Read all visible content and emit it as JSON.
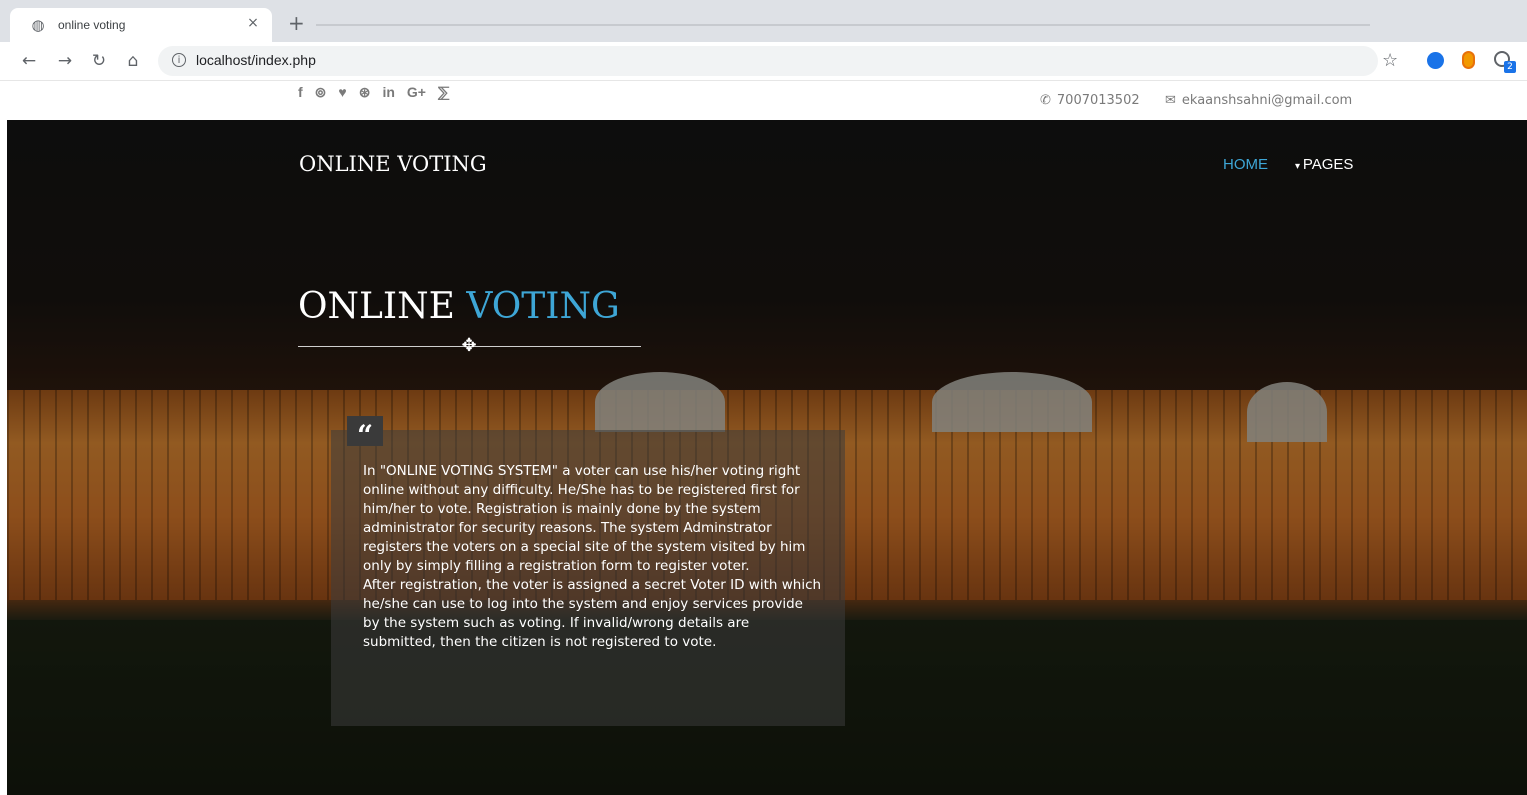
{
  "browser": {
    "tab_title": "online voting",
    "url": "localhost/index.php",
    "extension_badge": "2"
  },
  "icons": {
    "favicon": "globe-icon",
    "close": "close-icon",
    "new_tab": "plus-icon",
    "back": "back-arrow-icon",
    "forward": "forward-arrow-icon",
    "reload": "reload-icon",
    "home": "home-icon",
    "info": "info-icon",
    "bookmark": "star-icon",
    "phone": "phone-icon",
    "email": "envelope-icon",
    "quote": "quote-icon",
    "move_cursor": "move-cursor-icon"
  },
  "social": [
    "f",
    "⊚",
    "♥",
    "⊛",
    "in",
    "G+",
    "⅀"
  ],
  "contact": {
    "phone": "7007013502",
    "email": "ekaanshsahni@gmail.com"
  },
  "site": {
    "brand": "ONLINE VOTING",
    "nav_home": "HOME",
    "nav_pages": "PAGES",
    "heading_part1": "ONLINE",
    "heading_part2": "VOTING",
    "description_1": "In \"ONLINE VOTING SYSTEM\" a voter can use his/her voting right online without any difficulty. He/She has to be registered first for him/her to vote. Registration is mainly done by the system administrator for security reasons. The system Adminstrator registers the voters on a special site of the system visited by him only by simply filling a registration form to register voter.",
    "description_2": "After registration, the voter is assigned a secret Voter ID with which he/she can use to log into the system and enjoy services provide by the system such as voting. If invalid/wrong details are submitted, then the citizen is not registered to vote."
  },
  "colors": {
    "accent": "#3ea6d6",
    "tab_bar": "#dee1e6",
    "omnibox": "#f1f3f4"
  }
}
